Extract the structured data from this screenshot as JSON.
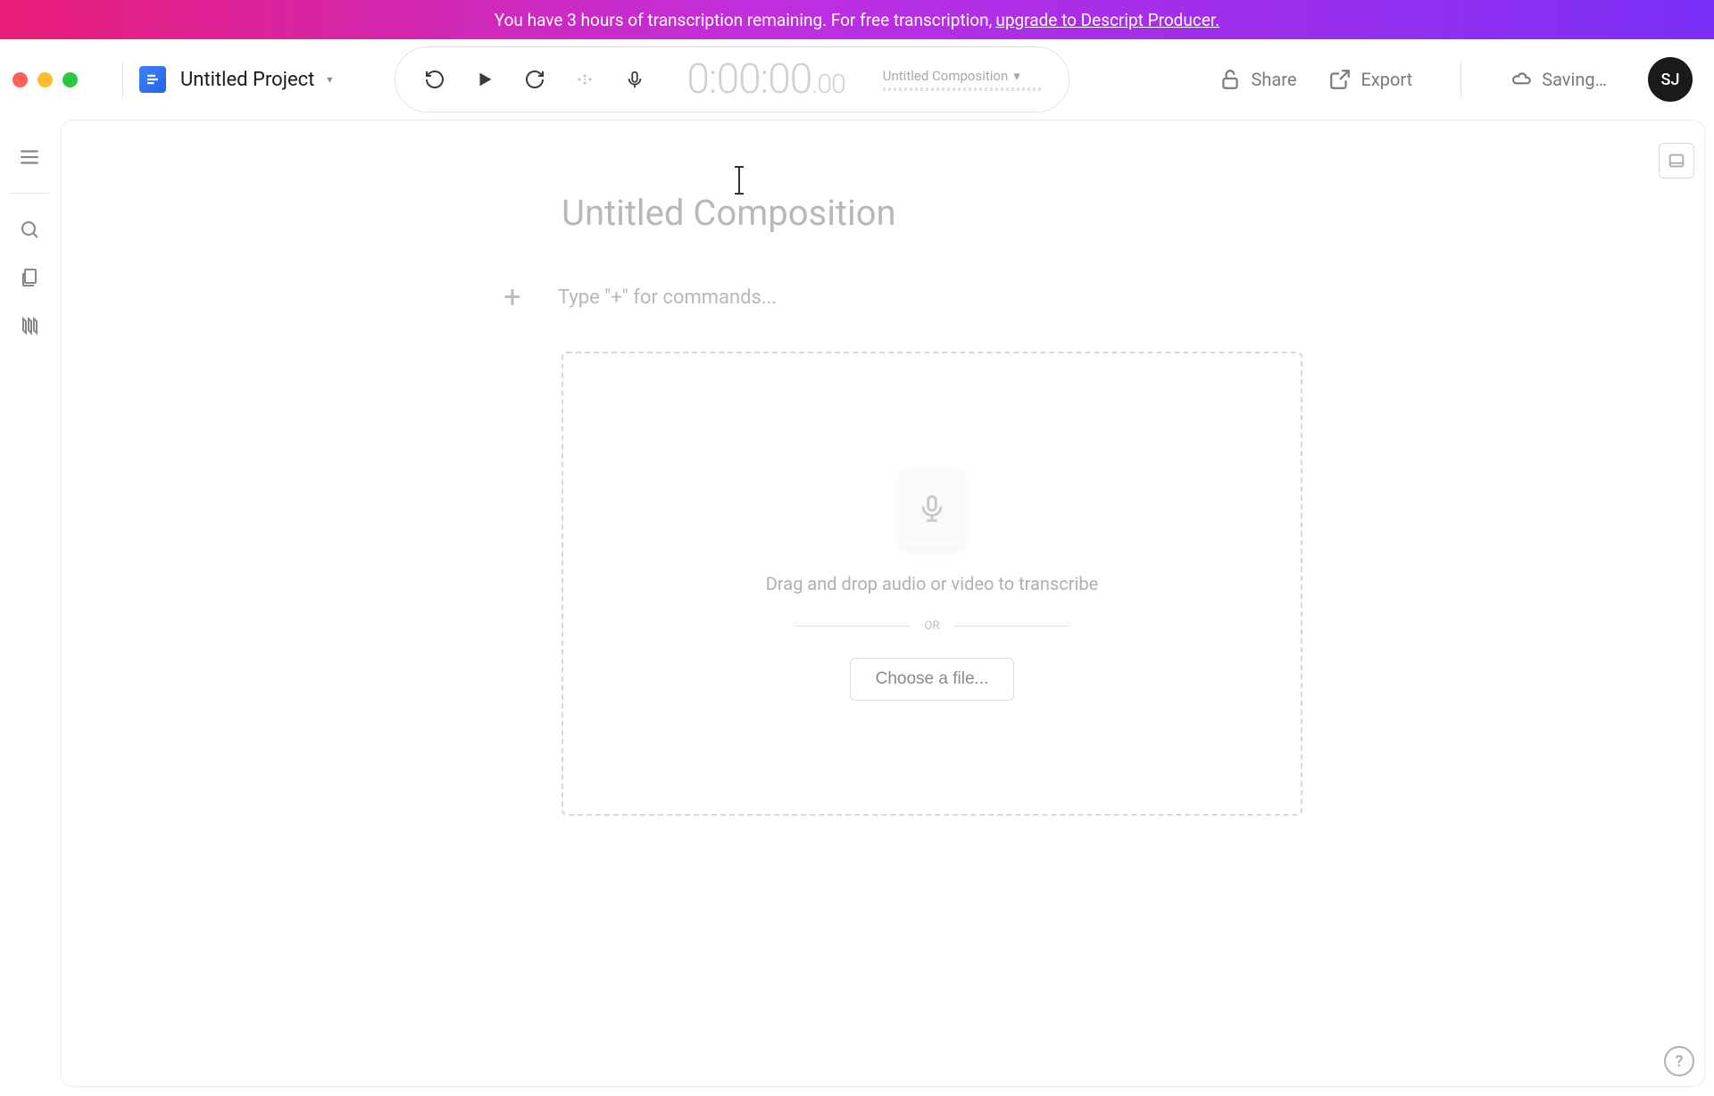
{
  "banner": {
    "text_prefix": "You have 3 hours of transcription remaining. For free transcription, ",
    "link_text": "upgrade to Descript Producer."
  },
  "toolbar": {
    "project_name": "Untitled Project",
    "timecode_main": "0:00:00",
    "timecode_frac": ".00",
    "composition_label": "Untitled Composition",
    "share_label": "Share",
    "export_label": "Export",
    "saving_label": "Saving…",
    "avatar_initials": "SJ"
  },
  "editor": {
    "title_placeholder": "Untitled Composition",
    "body_placeholder": "Type \"+\" for commands...",
    "dropzone_text": "Drag and drop audio or video to transcribe",
    "or_label": "OR",
    "choose_file_label": "Choose a file..."
  }
}
